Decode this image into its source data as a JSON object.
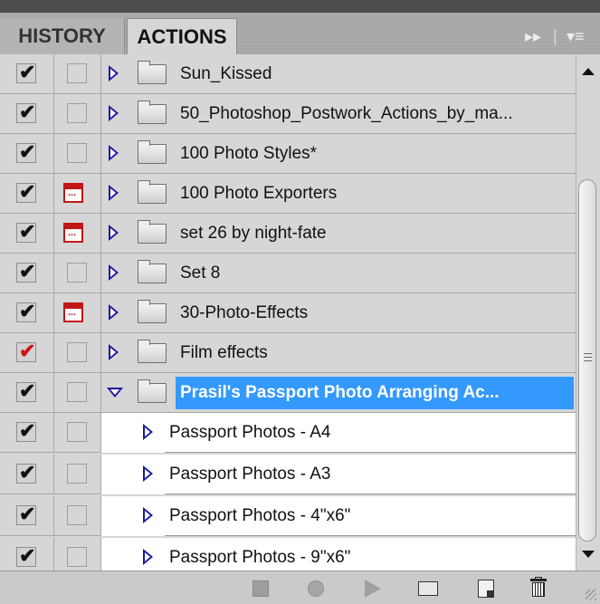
{
  "tabs": {
    "history": "HISTORY",
    "actions": "ACTIONS",
    "expand_glyph": "▸▸",
    "menu_glyph": "▾≡"
  },
  "actions": [
    {
      "name": "Sun_Kissed",
      "checked": true,
      "red": false,
      "dialog": false
    },
    {
      "name": "50_Photoshop_Postwork_Actions_by_ma...",
      "checked": true,
      "red": false,
      "dialog": false
    },
    {
      "name": "100 Photo Styles*",
      "checked": true,
      "red": false,
      "dialog": false
    },
    {
      "name": "100 Photo Exporters",
      "checked": true,
      "red": false,
      "dialog": true
    },
    {
      "name": "set 26 by night-fate",
      "checked": true,
      "red": false,
      "dialog": true
    },
    {
      "name": "Set 8",
      "checked": true,
      "red": false,
      "dialog": false
    },
    {
      "name": "30-Photo-Effects",
      "checked": true,
      "red": false,
      "dialog": true
    },
    {
      "name": "Film effects",
      "checked": true,
      "red": true,
      "dialog": false
    },
    {
      "name": "Prasil's Passport Photo Arranging Ac...",
      "checked": true,
      "red": false,
      "dialog": false,
      "expanded": true,
      "selected": true
    }
  ],
  "sub_actions": [
    {
      "name": "Passport Photos - A4"
    },
    {
      "name": "Passport Photos - A3"
    },
    {
      "name": "Passport Photos - 4\"x6\""
    },
    {
      "name": "Passport Photos - 9\"x6\""
    }
  ],
  "colors": {
    "selection": "#3399ff",
    "dialog_icon": "#c01818",
    "triangle": "#1a1a9a"
  }
}
